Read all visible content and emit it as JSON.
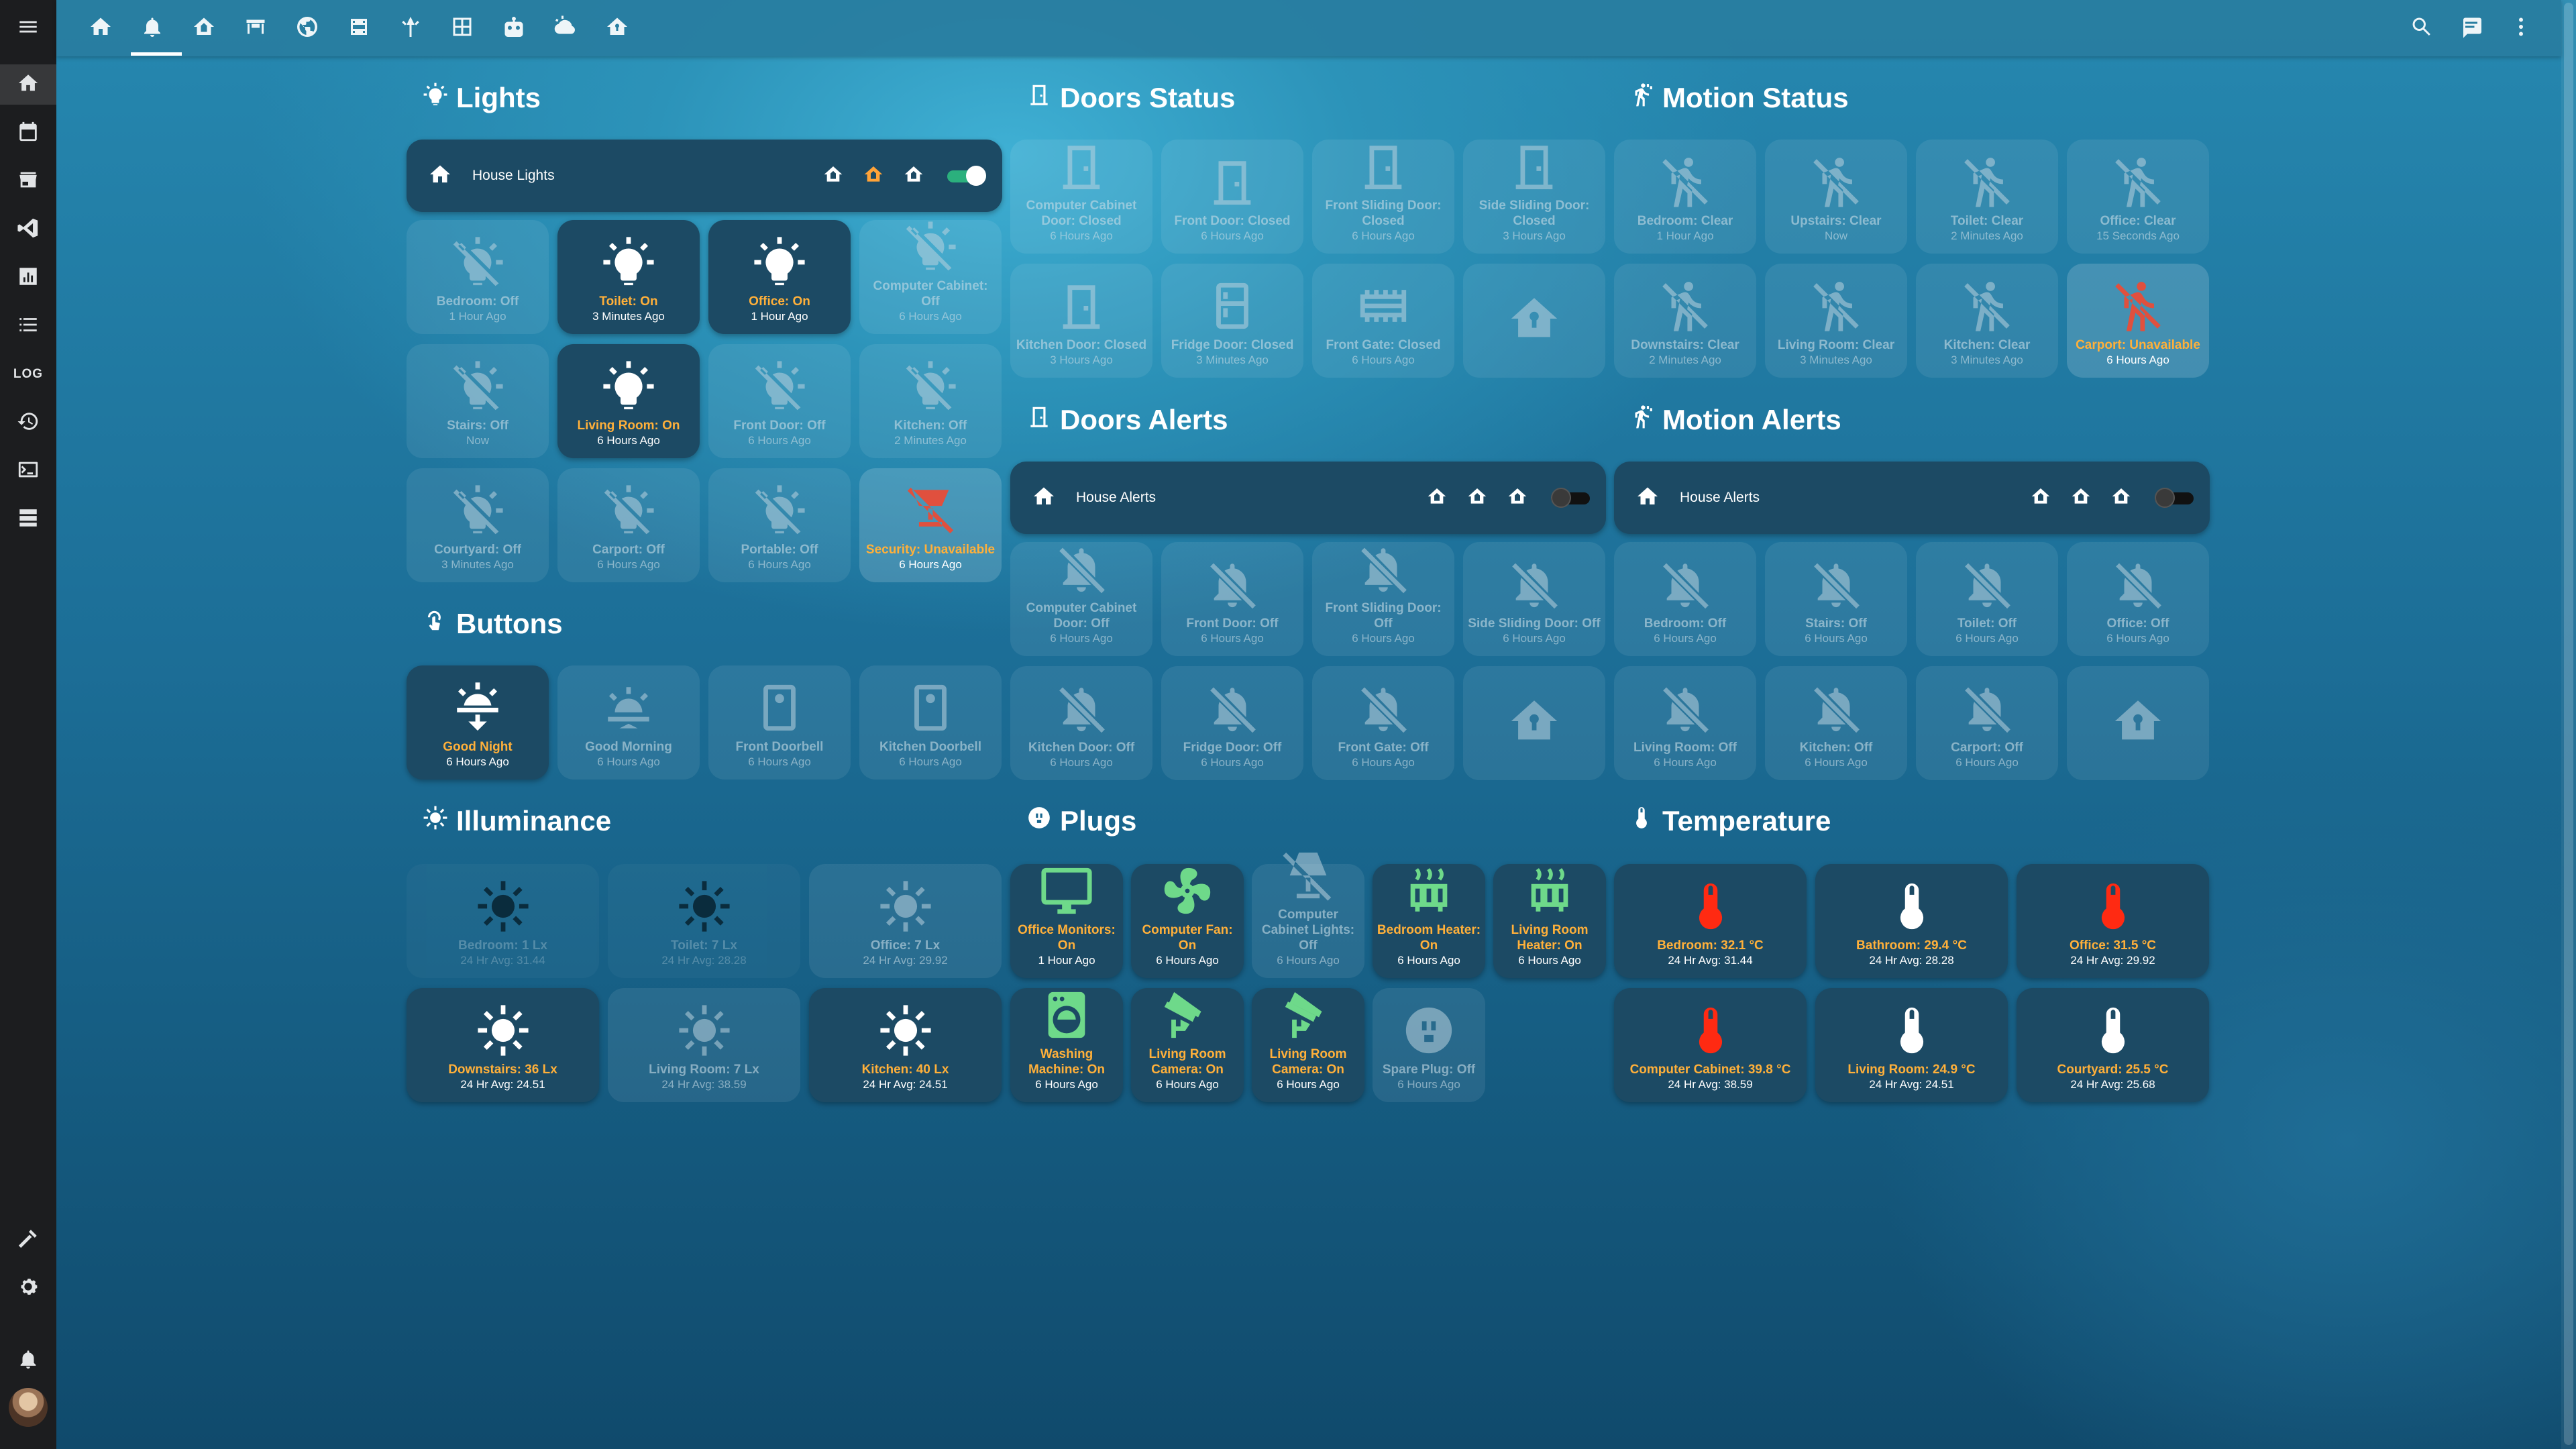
{
  "colors": {
    "accent_on": "#ffb03a",
    "tile_on": "#1c4a64",
    "sidebar": "#1c1d1f",
    "unavailable_icon": "#e0503e"
  },
  "sidebar": {
    "items": [
      "menu-icon",
      "home-icon",
      "calendar-icon",
      "store-icon",
      "vscode-icon",
      "chart-icon",
      "list-icon",
      "log",
      "history-icon",
      "terminal-icon",
      "server-icon",
      "hammer-icon",
      "gear-icon",
      "bell-icon",
      "avatar"
    ],
    "log_label": "LOG"
  },
  "topbar": {
    "views": [
      "home-icon",
      "bell-icon",
      "house-icon",
      "desk-icon",
      "globe-icon",
      "film-icon",
      "antenna-icon",
      "grid-icon",
      "robot-icon",
      "weather-icon",
      "security-house-icon"
    ],
    "active_view": 1,
    "right": [
      "search-icon",
      "chat-icon",
      "dots-vertical-icon"
    ]
  },
  "sections": {
    "lights": "Lights",
    "buttons": "Buttons",
    "illuminance": "Illuminance",
    "doors_status": "Doors Status",
    "doors_alerts": "Doors Alerts",
    "plugs": "Plugs",
    "motion_status": "Motion Status",
    "motion_alerts": "Motion Alerts",
    "temperature": "Temperature"
  },
  "controls": {
    "house_lights": {
      "label": "House Lights",
      "on": true
    },
    "door_house_alerts": {
      "label": "House Alerts",
      "on": false
    },
    "motion_house_alerts": {
      "label": "House Alerts",
      "on": false
    }
  },
  "lights": [
    {
      "name": "Bedroom: Off",
      "sub": "1 Hour Ago",
      "state": "off",
      "icon": "bulb-off-icon"
    },
    {
      "name": "Toilet: On",
      "sub": "3 Minutes Ago",
      "state": "on",
      "icon": "bulb-on-icon"
    },
    {
      "name": "Office: On",
      "sub": "1 Hour Ago",
      "state": "on",
      "icon": "bulb-on-icon"
    },
    {
      "name": "Computer Cabinet: Off",
      "sub": "6 Hours Ago",
      "state": "off",
      "icon": "bulb-off-icon"
    },
    {
      "name": "Stairs: Off",
      "sub": "Now",
      "state": "off",
      "icon": "bulb-off-icon"
    },
    {
      "name": "Living Room: On",
      "sub": "6 Hours Ago",
      "state": "on",
      "icon": "bulb-on-icon"
    },
    {
      "name": "Front Door: Off",
      "sub": "6 Hours Ago",
      "state": "off",
      "icon": "bulb-off-icon"
    },
    {
      "name": "Kitchen: Off",
      "sub": "2 Minutes Ago",
      "state": "off",
      "icon": "bulb-off-icon"
    },
    {
      "name": "Courtyard: Off",
      "sub": "3 Minutes Ago",
      "state": "off",
      "icon": "bulb-off-icon"
    },
    {
      "name": "Carport: Off",
      "sub": "6 Hours Ago",
      "state": "off",
      "icon": "bulb-off-icon"
    },
    {
      "name": "Portable: Off",
      "sub": "6 Hours Ago",
      "state": "off",
      "icon": "bulb-off-icon"
    },
    {
      "name": "Security: Unavailable",
      "sub": "6 Hours Ago",
      "state": "unavail",
      "icon": "floodlight-off-icon"
    }
  ],
  "buttons": [
    {
      "name": "Good Night",
      "sub": "6 Hours Ago",
      "state": "on",
      "icon": "sunset-icon"
    },
    {
      "name": "Good Morning",
      "sub": "6 Hours Ago",
      "state": "off",
      "icon": "sunrise-icon"
    },
    {
      "name": "Front Doorbell",
      "sub": "6 Hours Ago",
      "state": "off",
      "icon": "doorbell-icon"
    },
    {
      "name": "Kitchen Doorbell",
      "sub": "6 Hours Ago",
      "state": "off",
      "icon": "doorbell-icon"
    }
  ],
  "illuminance": [
    {
      "name": "Bedroom: 1 Lx",
      "sub": "24 Hr Avg: 31.44",
      "state": "faded",
      "icon": "sun-icon"
    },
    {
      "name": "Toilet: 7 Lx",
      "sub": "24 Hr Avg: 28.28",
      "state": "faded",
      "icon": "sun-icon"
    },
    {
      "name": "Office: 7 Lx",
      "sub": "24 Hr Avg: 29.92",
      "state": "off",
      "icon": "sun-icon"
    },
    {
      "name": "Downstairs: 36 Lx",
      "sub": "24 Hr Avg: 24.51",
      "state": "on",
      "icon": "sun-icon"
    },
    {
      "name": "Living Room: 7 Lx",
      "sub": "24 Hr Avg: 38.59",
      "state": "off",
      "icon": "sun-icon"
    },
    {
      "name": "Kitchen: 40 Lx",
      "sub": "24 Hr Avg: 24.51",
      "state": "on",
      "icon": "sun-icon"
    }
  ],
  "doors_status": [
    {
      "name": "Computer Cabinet Door: Closed",
      "sub": "6 Hours Ago",
      "state": "off",
      "icon": "door-closed-icon"
    },
    {
      "name": "Front Door: Closed",
      "sub": "6 Hours Ago",
      "state": "off",
      "icon": "door-closed-icon"
    },
    {
      "name": "Front Sliding Door: Closed",
      "sub": "6 Hours Ago",
      "state": "off",
      "icon": "door-closed-icon"
    },
    {
      "name": "Side Sliding Door: Closed",
      "sub": "3 Hours Ago",
      "state": "off",
      "icon": "door-closed-icon"
    },
    {
      "name": "Kitchen Door: Closed",
      "sub": "3 Hours Ago",
      "state": "off",
      "icon": "door-closed-icon"
    },
    {
      "name": "Fridge Door: Closed",
      "sub": "3 Minutes Ago",
      "state": "off",
      "icon": "fridge-icon"
    },
    {
      "name": "Front Gate: Closed",
      "sub": "6 Hours Ago",
      "state": "off",
      "icon": "gate-icon"
    },
    {
      "name": "",
      "sub": "",
      "state": "off",
      "icon": "security-house-icon"
    }
  ],
  "doors_alerts": [
    {
      "name": "Computer Cabinet Door: Off",
      "sub": "6 Hours Ago",
      "state": "off",
      "icon": "bell-off-icon"
    },
    {
      "name": "Front Door: Off",
      "sub": "6 Hours Ago",
      "state": "off",
      "icon": "bell-off-icon"
    },
    {
      "name": "Front Sliding Door: Off",
      "sub": "6 Hours Ago",
      "state": "off",
      "icon": "bell-off-icon"
    },
    {
      "name": "Side Sliding Door: Off",
      "sub": "6 Hours Ago",
      "state": "off",
      "icon": "bell-off-icon"
    },
    {
      "name": "Kitchen Door: Off",
      "sub": "6 Hours Ago",
      "state": "off",
      "icon": "bell-off-icon"
    },
    {
      "name": "Fridge Door: Off",
      "sub": "6 Hours Ago",
      "state": "off",
      "icon": "bell-off-icon"
    },
    {
      "name": "Front Gate: Off",
      "sub": "6 Hours Ago",
      "state": "off",
      "icon": "bell-off-icon"
    },
    {
      "name": "",
      "sub": "",
      "state": "off",
      "icon": "security-house-icon"
    }
  ],
  "plugs": [
    {
      "name": "Office Monitors: On",
      "sub": "1 Hour Ago",
      "state": "on hl",
      "icon": "monitor-icon"
    },
    {
      "name": "Computer Fan: On",
      "sub": "6 Hours Ago",
      "state": "on hl",
      "icon": "fan-icon"
    },
    {
      "name": "Computer Cabinet Lights: Off",
      "sub": "6 Hours Ago",
      "state": "off",
      "icon": "lamp-off-icon"
    },
    {
      "name": "Bedroom Heater: On",
      "sub": "6 Hours Ago",
      "state": "on hl",
      "icon": "heater-icon"
    },
    {
      "name": "Living Room Heater: On",
      "sub": "6 Hours Ago",
      "state": "on hl",
      "icon": "heater-icon"
    },
    {
      "name": "Washing Machine: On",
      "sub": "6 Hours Ago",
      "state": "on hl",
      "icon": "washing-machine-icon"
    },
    {
      "name": "Living Room Camera: On",
      "sub": "6 Hours Ago",
      "state": "on hl",
      "icon": "cctv-icon"
    },
    {
      "name": "Living Room Camera: On",
      "sub": "6 Hours Ago",
      "state": "on hl",
      "icon": "cctv-icon"
    },
    {
      "name": "Spare Plug: Off",
      "sub": "6 Hours Ago",
      "state": "off",
      "icon": "socket-icon"
    }
  ],
  "motion_status": [
    {
      "name": "Bedroom: Clear",
      "sub": "1 Hour Ago",
      "state": "off",
      "icon": "motion-sensor-off-icon"
    },
    {
      "name": "Upstairs: Clear",
      "sub": "Now",
      "state": "off",
      "icon": "motion-sensor-off-icon"
    },
    {
      "name": "Toilet: Clear",
      "sub": "2 Minutes Ago",
      "state": "off",
      "icon": "motion-sensor-off-icon"
    },
    {
      "name": "Office: Clear",
      "sub": "15 Seconds Ago",
      "state": "off",
      "icon": "motion-sensor-off-icon"
    },
    {
      "name": "Downstairs: Clear",
      "sub": "2 Minutes Ago",
      "state": "off",
      "icon": "motion-sensor-off-icon"
    },
    {
      "name": "Living Room: Clear",
      "sub": "3 Minutes Ago",
      "state": "off",
      "icon": "motion-sensor-off-icon"
    },
    {
      "name": "Kitchen: Clear",
      "sub": "3 Minutes Ago",
      "state": "off",
      "icon": "motion-sensor-off-icon"
    },
    {
      "name": "Carport: Unavailable",
      "sub": "6 Hours Ago",
      "state": "unavail",
      "icon": "motion-sensor-off-icon"
    }
  ],
  "motion_alerts": [
    {
      "name": "Bedroom: Off",
      "sub": "6 Hours Ago",
      "state": "off",
      "icon": "bell-off-icon"
    },
    {
      "name": "Stairs: Off",
      "sub": "6 Hours Ago",
      "state": "off",
      "icon": "bell-off-icon"
    },
    {
      "name": "Toilet: Off",
      "sub": "6 Hours Ago",
      "state": "off",
      "icon": "bell-off-icon"
    },
    {
      "name": "Office: Off",
      "sub": "6 Hours Ago",
      "state": "off",
      "icon": "bell-off-icon"
    },
    {
      "name": "Living Room: Off",
      "sub": "6 Hours Ago",
      "state": "off",
      "icon": "bell-off-icon"
    },
    {
      "name": "Kitchen: Off",
      "sub": "6 Hours Ago",
      "state": "off",
      "icon": "bell-off-icon"
    },
    {
      "name": "Carport: Off",
      "sub": "6 Hours Ago",
      "state": "off",
      "icon": "bell-off-icon"
    },
    {
      "name": "",
      "sub": "",
      "state": "off",
      "icon": "security-house-icon"
    }
  ],
  "temperature": [
    {
      "name": "Bedroom: 32.1 °C",
      "sub": "24 Hr Avg: 31.44",
      "state": "on therm-hot",
      "icon": "thermometer-icon"
    },
    {
      "name": "Bathroom: 29.4 °C",
      "sub": "24 Hr Avg: 28.28",
      "state": "on",
      "icon": "thermometer-icon"
    },
    {
      "name": "Office: 31.5 °C",
      "sub": "24 Hr Avg: 29.92",
      "state": "on therm-hot",
      "icon": "thermometer-icon"
    },
    {
      "name": "Computer Cabinet: 39.8 °C",
      "sub": "24 Hr Avg: 38.59",
      "state": "on therm-hot",
      "icon": "thermometer-icon"
    },
    {
      "name": "Living Room: 24.9 °C",
      "sub": "24 Hr Avg: 24.51",
      "state": "on",
      "icon": "thermometer-icon"
    },
    {
      "name": "Courtyard: 25.5 °C",
      "sub": "24 Hr Avg: 25.68",
      "state": "on",
      "icon": "thermometer-icon"
    }
  ]
}
